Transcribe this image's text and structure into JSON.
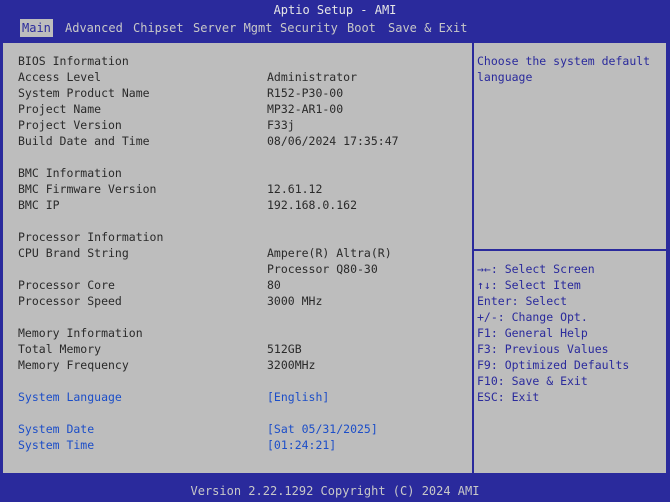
{
  "app_title": "Aptio Setup - AMI",
  "menu": [
    "Main",
    "Advanced",
    "Chipset",
    "Server Mgmt",
    "Security",
    "Boot",
    "Save & Exit"
  ],
  "bios": {
    "section": "BIOS Information",
    "access_level_label": "Access Level",
    "access_level": "Administrator",
    "product_name_label": "System Product Name",
    "product_name": "R152-P30-00",
    "project_name_label": "Project Name",
    "project_name": "MP32-AR1-00",
    "project_version_label": "Project Version",
    "project_version": "F33j",
    "build_label": "Build Date and Time",
    "build": "08/06/2024 17:35:47"
  },
  "bmc": {
    "section": "BMC Information",
    "fw_label": "BMC Firmware Version",
    "fw": "12.61.12",
    "ip_label": "BMC IP",
    "ip": "192.168.0.162"
  },
  "processor": {
    "section": "Processor Information",
    "brand_label": "CPU Brand String",
    "brand_line1": "Ampere(R) Altra(R)",
    "brand_line2": "Processor Q80-30",
    "core_label": "Processor Core",
    "core": "80",
    "speed_label": "Processor Speed",
    "speed": "3000 MHz"
  },
  "memory": {
    "section": "Memory Information",
    "total_label": "Total Memory",
    "total": "512GB",
    "freq_label": "Memory Frequency",
    "freq": "3200MHz"
  },
  "settings": {
    "language_label": "System Language",
    "language": "[English]",
    "date_label": "System Date",
    "date": "[Sat 05/31/2025]",
    "time_label": "System Time",
    "time": "[01:24:21]"
  },
  "help": "Choose the system default language",
  "keys": [
    "→←: Select Screen",
    "↑↓: Select Item",
    "Enter: Select",
    "+/-: Change Opt.",
    "F1: General Help",
    "F3: Previous Values",
    "F9: Optimized Defaults",
    "F10: Save & Exit",
    "ESC: Exit"
  ],
  "footer": "Version 2.22.1292 Copyright (C) 2024 AMI"
}
